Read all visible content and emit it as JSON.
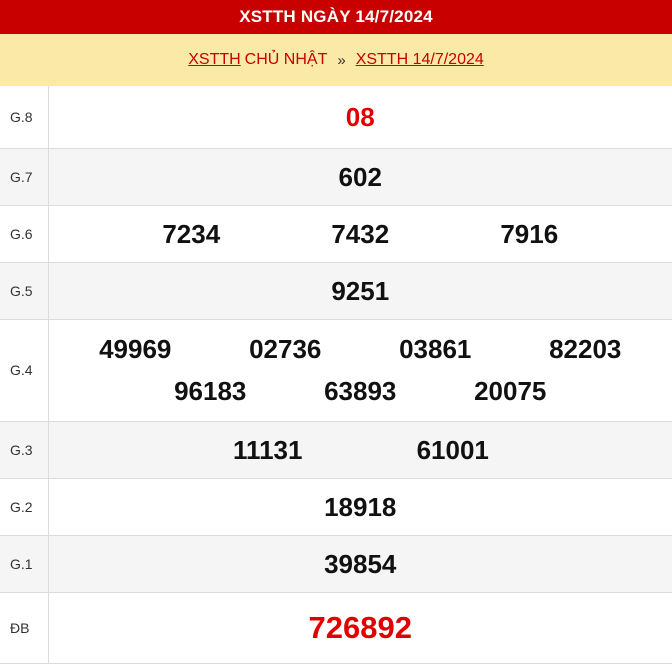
{
  "header": {
    "title": "XSTTH NGÀY 14/7/2024"
  },
  "breadcrumb": {
    "link1": "XSTTH",
    "text1": "CHỦ NHẬT",
    "separator": "»",
    "link2": "XSTTH 14/7/2024"
  },
  "prizes": {
    "g8": {
      "label": "G.8",
      "numbers": [
        "08"
      ]
    },
    "g7": {
      "label": "G.7",
      "numbers": [
        "602"
      ]
    },
    "g6": {
      "label": "G.6",
      "numbers": [
        "7234",
        "7432",
        "7916"
      ]
    },
    "g5": {
      "label": "G.5",
      "numbers": [
        "9251"
      ]
    },
    "g4": {
      "label": "G.4",
      "numbers": [
        "49969",
        "02736",
        "03861",
        "82203",
        "96183",
        "63893",
        "20075"
      ]
    },
    "g3": {
      "label": "G.3",
      "numbers": [
        "11131",
        "61001"
      ]
    },
    "g2": {
      "label": "G.2",
      "numbers": [
        "18918"
      ]
    },
    "g1": {
      "label": "G.1",
      "numbers": [
        "39854"
      ]
    },
    "db": {
      "label": "ĐB",
      "numbers": [
        "726892"
      ]
    }
  },
  "colors": {
    "header_bg": "#c80000",
    "subheader_bg": "#fbe9a8",
    "highlight": "#e00000"
  }
}
